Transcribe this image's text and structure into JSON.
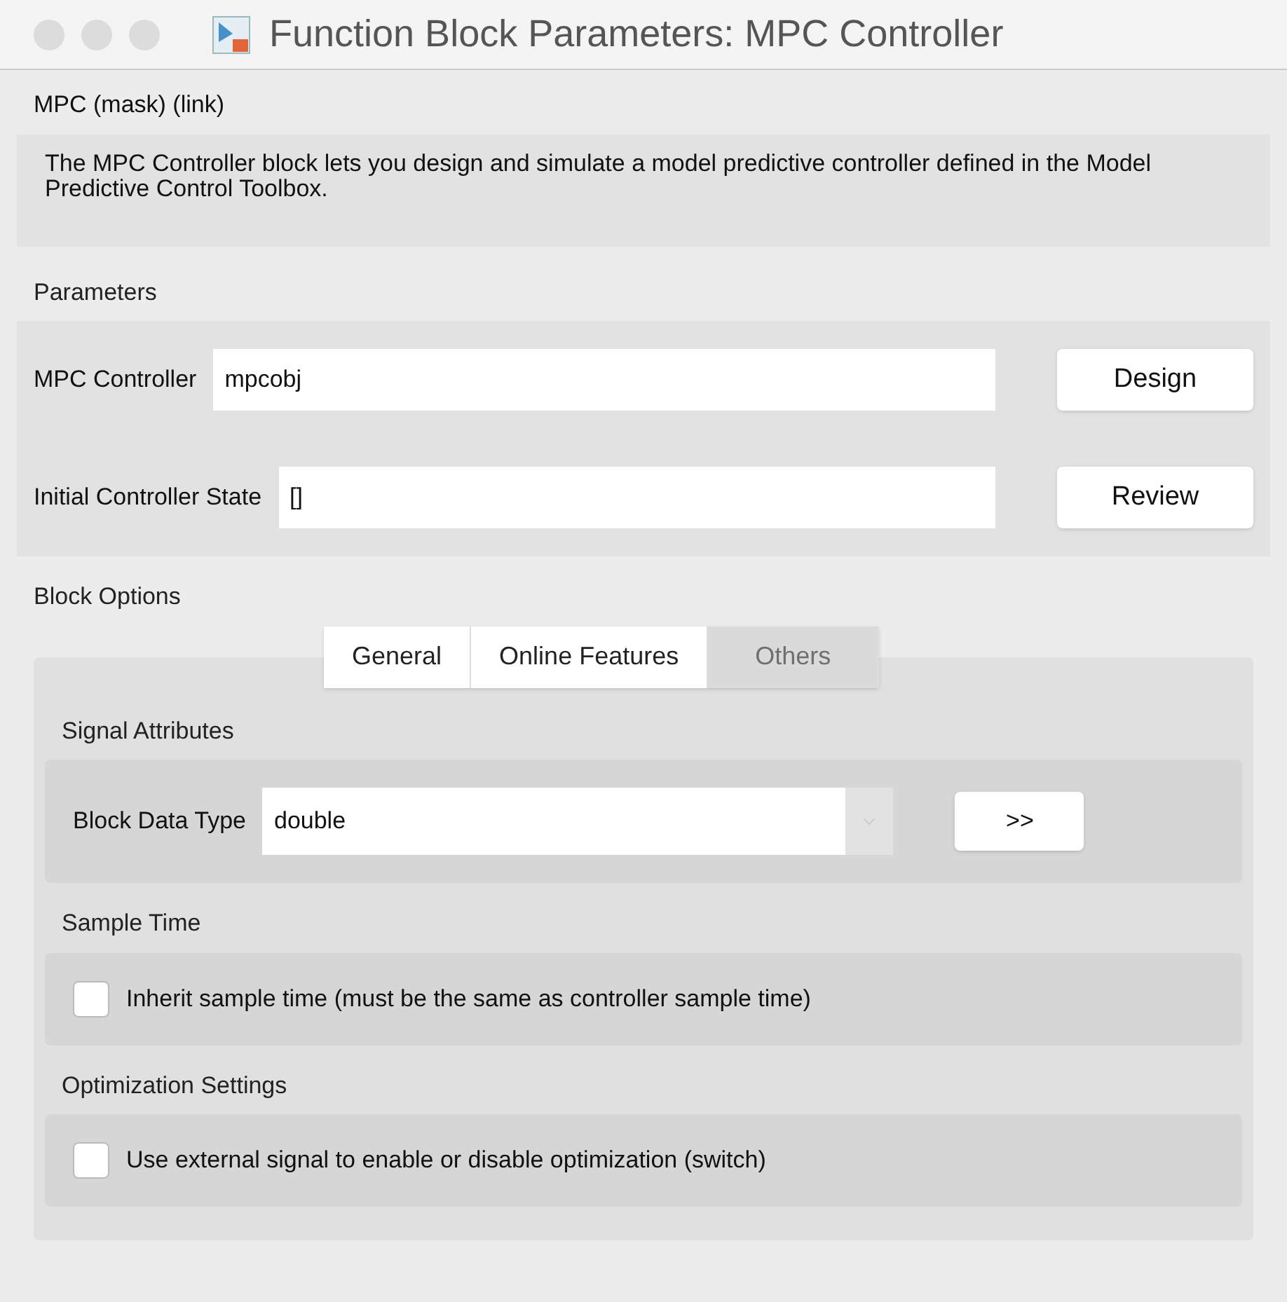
{
  "window": {
    "title": "Function Block Parameters: MPC Controller"
  },
  "header": {
    "title": "MPC (mask) (link)",
    "description": "The MPC Controller block lets you design and simulate a model predictive controller defined in the Model Predictive Control Toolbox."
  },
  "parameters": {
    "title": "Parameters",
    "rows": [
      {
        "label": "MPC Controller",
        "value": "mpcobj",
        "button": "Design"
      },
      {
        "label": "Initial Controller State",
        "value": "[]",
        "button": "Review"
      }
    ]
  },
  "block_options": {
    "title": "Block Options",
    "tabs": [
      {
        "label": "General",
        "selected": false
      },
      {
        "label": "Online Features",
        "selected": false
      },
      {
        "label": "Others",
        "selected": true
      }
    ],
    "sections": [
      {
        "title": "Signal Attributes",
        "kind": "dropdown",
        "label": "Block Data Type",
        "value": "double",
        "button": ">>"
      },
      {
        "title": "Sample Time",
        "kind": "checkbox",
        "label": "Inherit sample time (must be the same as controller sample time)",
        "checked": false
      },
      {
        "title": "Optimization Settings",
        "kind": "checkbox",
        "label": "Use external signal to enable or disable optimization (switch)",
        "checked": false
      }
    ]
  }
}
